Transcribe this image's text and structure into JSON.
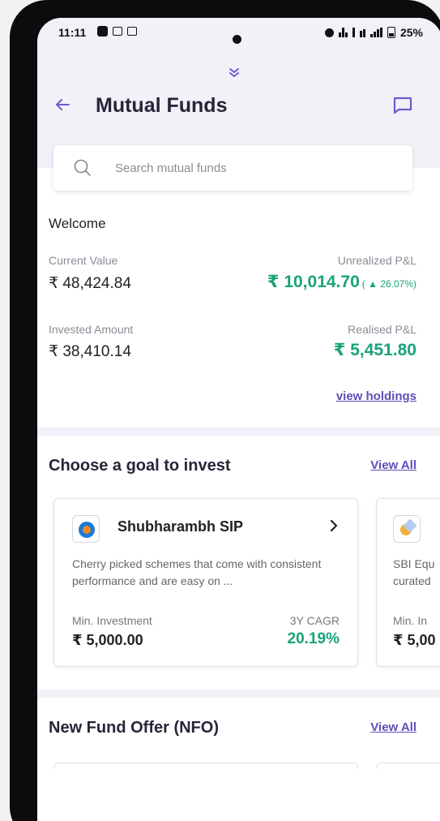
{
  "status_bar": {
    "time": "11:11",
    "battery": "25%"
  },
  "header": {
    "title": "Mutual Funds"
  },
  "search": {
    "placeholder": "Search mutual funds"
  },
  "portfolio": {
    "welcome": "Welcome",
    "current_value_label": "Current Value",
    "current_value": "₹ 48,424.84",
    "unrealized_label": "Unrealized P&L",
    "unrealized_value": "₹ 10,014.70",
    "unrealized_pct": "( ▲ 26.07%)",
    "invested_label": "Invested Amount",
    "invested_value": "₹ 38,410.14",
    "realised_label": "Realised P&L",
    "realised_value": "₹ 5,451.80",
    "view_holdings": "view holdings"
  },
  "goals": {
    "title": "Choose a goal to invest",
    "view_all": "View All",
    "cards": [
      {
        "name": "Shubharambh SIP",
        "description": "Cherry picked schemes that come with consistent performance and are easy on ...",
        "min_label": "Min. Investment",
        "min_value": "₹ 5,000.00",
        "cagr_label": "3Y CAGR",
        "cagr_value": "20.19%"
      },
      {
        "description": "SBI Equ curated",
        "min_label": "Min. In",
        "min_value": "₹ 5,00"
      }
    ]
  },
  "nfo": {
    "title": "New Fund Offer (NFO)",
    "view_all": "View All"
  },
  "colors": {
    "accent": "#6d5bd0",
    "link": "#5b4fb8",
    "positive": "#1aa37a",
    "header_bg": "#f2f1f8"
  }
}
